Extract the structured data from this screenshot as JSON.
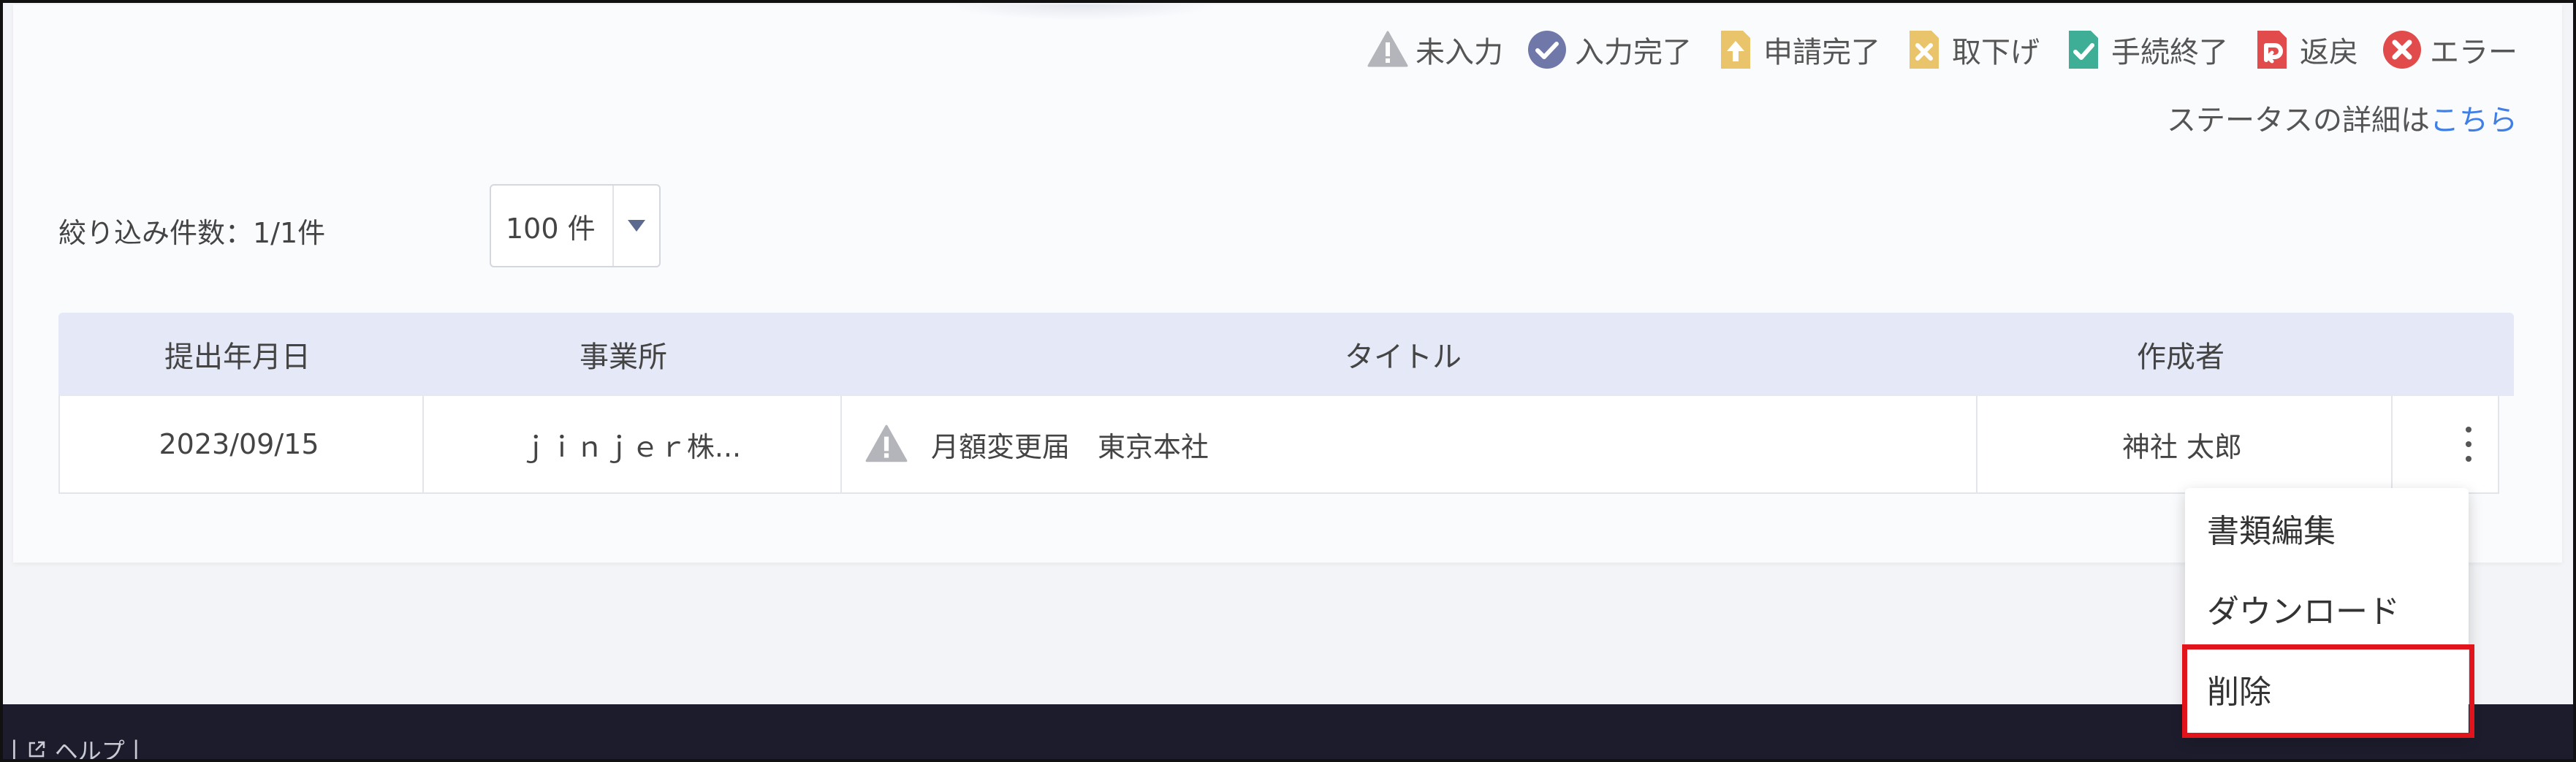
{
  "legend": [
    {
      "label": "未入力",
      "icon": "warning-icon",
      "color": "#b3b5ba"
    },
    {
      "label": "入力完了",
      "icon": "check-circle-icon",
      "color": "#6f78a8"
    },
    {
      "label": "申請完了",
      "icon": "upload-doc-icon",
      "color": "#e9c46a"
    },
    {
      "label": "取下げ",
      "icon": "cancel-doc-icon",
      "color": "#e9c46a"
    },
    {
      "label": "手続終了",
      "icon": "done-doc-icon",
      "color": "#3fae96"
    },
    {
      "label": "返戻",
      "icon": "return-doc-icon",
      "color": "#e24b4b"
    },
    {
      "label": "エラー",
      "icon": "error-circle-icon",
      "color": "#e24b4b"
    }
  ],
  "status_detail": {
    "prefix": "ステータスの詳細は",
    "link": "こちら"
  },
  "filter": {
    "count_label": "絞り込み件数：1/1件",
    "per_page": "100 件"
  },
  "table": {
    "headers": [
      "提出年月日",
      "事業所",
      "タイトル",
      "作成者"
    ],
    "rows": [
      {
        "date": "2023/09/15",
        "office": "ｊｉｎｊｅｒ株...",
        "title": "月額変更届　東京本社",
        "status_icon": "warning-icon",
        "author": "神社 太郎"
      }
    ]
  },
  "row_menu": [
    "書類編集",
    "ダウンロード",
    "削除"
  ],
  "footer": {
    "help": "ヘルプ"
  },
  "colors": {
    "accent_link": "#3f7fe6",
    "highlight": "#e0141a",
    "footer_bg": "#1c1c2c",
    "table_header_bg": "#e5e8f6"
  }
}
